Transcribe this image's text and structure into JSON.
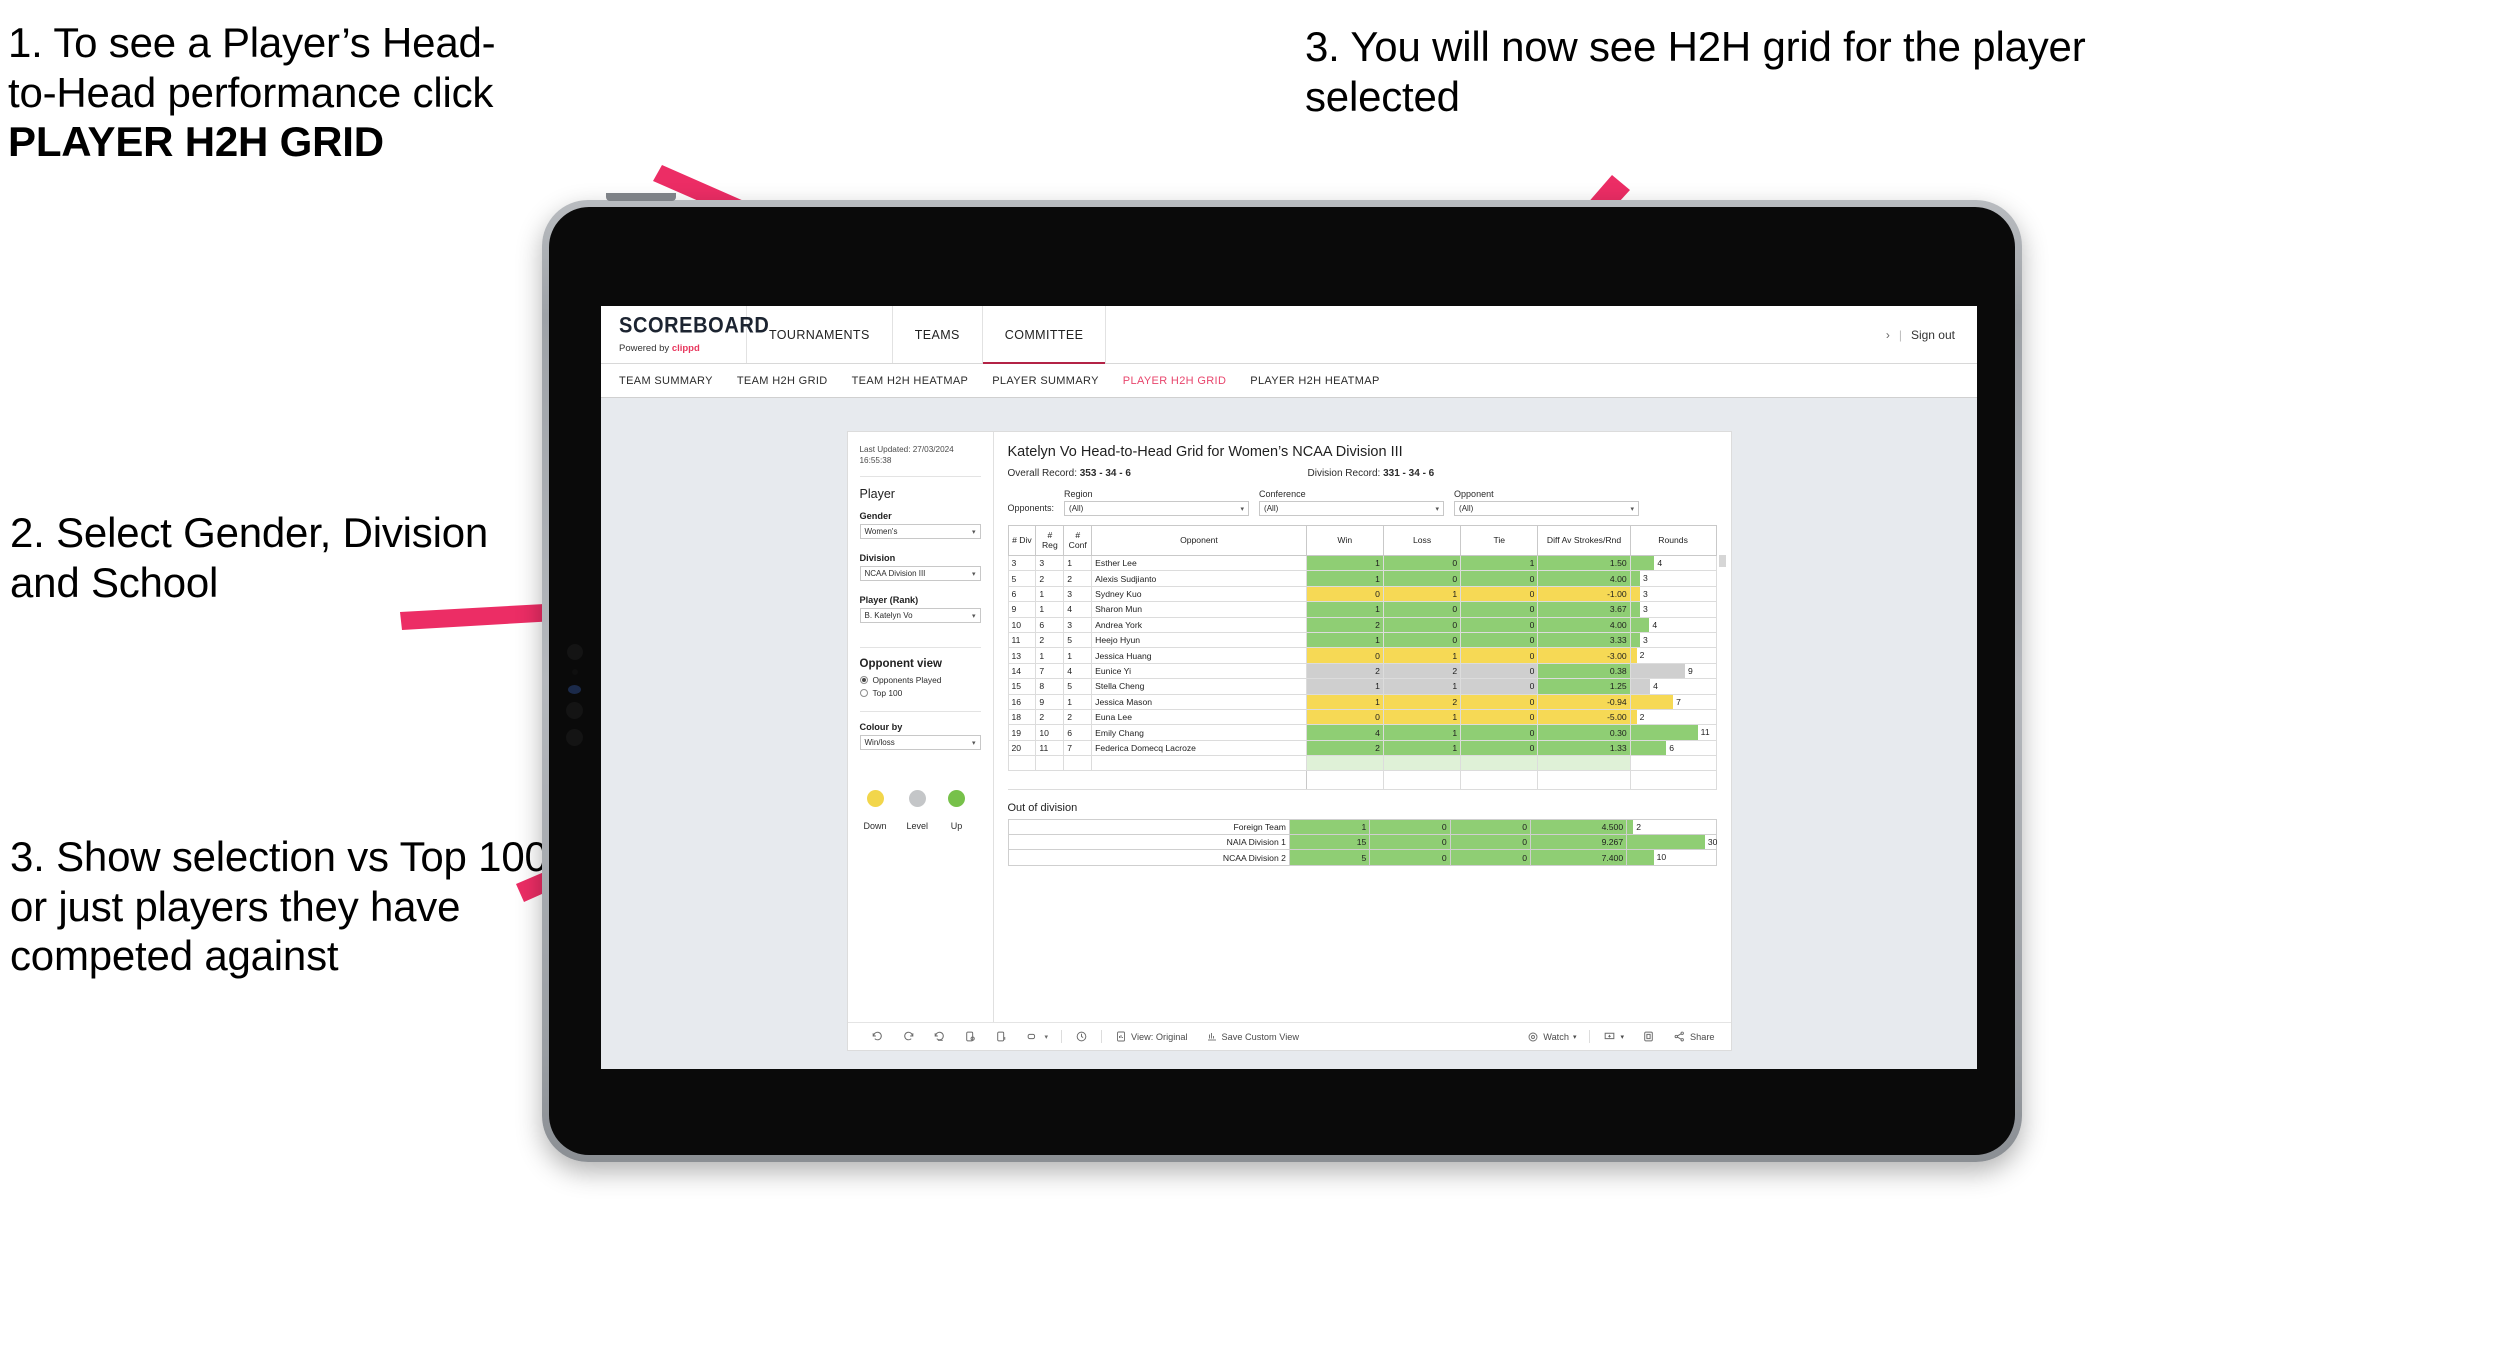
{
  "annotations": {
    "a1_line1": "1. To see a Player’s Head-",
    "a1_line2": "to-Head performance click",
    "a1_bold": "PLAYER H2H GRID",
    "a2": "2. Select Gender, Division and School",
    "a3": "3. Show selection vs Top 100 or just players they have competed against",
    "a4": "3. You will now see H2H grid for the player selected",
    "arrow_color": "#ec2d65"
  },
  "app": {
    "logo_word": "SCOREBOARD",
    "logo_sub_prefix": "Powered by ",
    "logo_brand": "clippd",
    "top_nav": [
      {
        "label": "TOURNAMENTS",
        "active": false
      },
      {
        "label": "TEAMS",
        "active": false
      },
      {
        "label": "COMMITTEE",
        "active": true
      }
    ],
    "account_chevron": "›",
    "account_sep": "|",
    "sign_out": "Sign out",
    "sub_nav": [
      {
        "label": "TEAM SUMMARY",
        "active": false
      },
      {
        "label": "TEAM H2H GRID",
        "active": false
      },
      {
        "label": "TEAM H2H HEATMAP",
        "active": false
      },
      {
        "label": "PLAYER SUMMARY",
        "active": false
      },
      {
        "label": "PLAYER H2H GRID",
        "active": true
      },
      {
        "label": "PLAYER H2H HEATMAP",
        "active": false
      }
    ],
    "accent_pink": "#e8456c"
  },
  "sidebar": {
    "last_updated": "Last Updated: 27/03/2024 16:55:38",
    "player_heading": "Player",
    "gender_label": "Gender",
    "gender_value": "Women's",
    "division_label": "Division",
    "division_value": "NCAA Division III",
    "player_rank_label": "Player (Rank)",
    "player_rank_value": "B. Katelyn Vo",
    "opponent_view_heading": "Opponent view",
    "opponent_view_options": [
      {
        "label": "Opponents Played",
        "selected": true
      },
      {
        "label": "Top 100",
        "selected": false
      }
    ],
    "colour_by_label": "Colour by",
    "colour_by_value": "Win/loss",
    "legend": [
      {
        "label": "Down",
        "color": "#f2d64b"
      },
      {
        "label": "Level",
        "color": "#c4c6c8"
      },
      {
        "label": "Up",
        "color": "#77c14a"
      }
    ]
  },
  "main": {
    "title": "Katelyn Vo Head-to-Head Grid for Women’s NCAA Division III",
    "overall_record_label": "Overall Record:",
    "overall_record_value": "353 -  34 - 6",
    "division_record_label": "Division Record:",
    "division_record_value": "331 -  34 - 6",
    "opponents_label": "Opponents:",
    "filters": [
      {
        "label": "Region",
        "value": "(All)"
      },
      {
        "label": "Conference",
        "value": "(All)"
      },
      {
        "label": "Opponent",
        "value": "(All)"
      }
    ],
    "columns": [
      "# Div",
      "# Reg",
      "# Conf",
      "Opponent",
      "Win",
      "Loss",
      "Tie",
      "Diff Av Strokes/Rnd",
      "Rounds"
    ],
    "out_of_division_title": "Out of division"
  },
  "chart_data": {
    "type": "table",
    "title": "Katelyn Vo Head-to-Head Grid for Women’s NCAA Division III",
    "columns": [
      "# Div",
      "# Reg",
      "# Conf",
      "Opponent",
      "Win",
      "Loss",
      "Tie",
      "Diff Av Strokes/Rnd",
      "Rounds"
    ],
    "rows": [
      {
        "div": "3",
        "reg": "3",
        "conf": "1",
        "opponent": "Esther Lee",
        "win": "1",
        "loss": "0",
        "tie": "1",
        "diff": "1.50",
        "rounds": "4",
        "color": "g",
        "bar_pct": 28
      },
      {
        "div": "5",
        "reg": "2",
        "conf": "2",
        "opponent": "Alexis Sudjianto",
        "win": "1",
        "loss": "0",
        "tie": "0",
        "diff": "4.00",
        "rounds": "3",
        "color": "g",
        "bar_pct": 11
      },
      {
        "div": "6",
        "reg": "1",
        "conf": "3",
        "opponent": "Sydney Kuo",
        "win": "0",
        "loss": "1",
        "tie": "0",
        "diff": "-1.00",
        "rounds": "3",
        "color": "y",
        "bar_pct": 11
      },
      {
        "div": "9",
        "reg": "1",
        "conf": "4",
        "opponent": "Sharon Mun",
        "win": "1",
        "loss": "0",
        "tie": "0",
        "diff": "3.67",
        "rounds": "3",
        "color": "g",
        "bar_pct": 11
      },
      {
        "div": "10",
        "reg": "6",
        "conf": "3",
        "opponent": "Andrea York",
        "win": "2",
        "loss": "0",
        "tie": "0",
        "diff": "4.00",
        "rounds": "4",
        "color": "g",
        "bar_pct": 22
      },
      {
        "div": "11",
        "reg": "2",
        "conf": "5",
        "opponent": "Heejo Hyun",
        "win": "1",
        "loss": "0",
        "tie": "0",
        "diff": "3.33",
        "rounds": "3",
        "color": "g",
        "bar_pct": 11
      },
      {
        "div": "13",
        "reg": "1",
        "conf": "1",
        "opponent": "Jessica Huang",
        "win": "0",
        "loss": "1",
        "tie": "0",
        "diff": "-3.00",
        "rounds": "2",
        "color": "y",
        "bar_pct": 7
      },
      {
        "div": "14",
        "reg": "7",
        "conf": "4",
        "opponent": "Eunice Yi",
        "win": "2",
        "loss": "2",
        "tie": "0",
        "diff": "0.38",
        "rounds": "9",
        "color": "gr",
        "bar_pct": 64,
        "diff_color": "g"
      },
      {
        "div": "15",
        "reg": "8",
        "conf": "5",
        "opponent": "Stella Cheng",
        "win": "1",
        "loss": "1",
        "tie": "0",
        "diff": "1.25",
        "rounds": "4",
        "color": "gr",
        "bar_pct": 23,
        "diff_color": "g"
      },
      {
        "div": "16",
        "reg": "9",
        "conf": "1",
        "opponent": "Jessica Mason",
        "win": "1",
        "loss": "2",
        "tie": "0",
        "diff": "-0.94",
        "rounds": "7",
        "color": "y",
        "bar_pct": 50
      },
      {
        "div": "18",
        "reg": "2",
        "conf": "2",
        "opponent": "Euna Lee",
        "win": "0",
        "loss": "1",
        "tie": "0",
        "diff": "-5.00",
        "rounds": "2",
        "color": "y",
        "bar_pct": 7
      },
      {
        "div": "19",
        "reg": "10",
        "conf": "6",
        "opponent": "Emily Chang",
        "win": "4",
        "loss": "1",
        "tie": "0",
        "diff": "0.30",
        "rounds": "11",
        "color": "g",
        "bar_pct": 79
      },
      {
        "div": "20",
        "reg": "11",
        "conf": "7",
        "opponent": "Federica Domecq Lacroze",
        "win": "2",
        "loss": "1",
        "tie": "0",
        "diff": "1.33",
        "rounds": "6",
        "color": "g",
        "bar_pct": 42
      }
    ],
    "out_of_division": [
      {
        "name": "Foreign Team",
        "win": "1",
        "loss": "0",
        "tie": "0",
        "diff": "4.500",
        "rounds": "2",
        "color": "g",
        "bar_pct": 7
      },
      {
        "name": "NAIA Division 1",
        "win": "15",
        "loss": "0",
        "tie": "0",
        "diff": "9.267",
        "rounds": "30",
        "color": "g",
        "bar_pct": 88
      },
      {
        "name": "NCAA Division 2",
        "win": "5",
        "loss": "0",
        "tie": "0",
        "diff": "7.400",
        "rounds": "10",
        "color": "g",
        "bar_pct": 30
      }
    ],
    "colors": {
      "up": "#8fce74",
      "down": "#f6d955",
      "level": "#cfcfcf"
    }
  },
  "toolbar": {
    "items": [
      {
        "name": "undo-icon",
        "label": ""
      },
      {
        "name": "redo-icon",
        "label": ""
      },
      {
        "name": "revert-icon",
        "label": ""
      },
      {
        "name": "refresh-icon",
        "label": ""
      },
      {
        "name": "pause-icon",
        "label": ""
      },
      {
        "name": "alerts-icon",
        "label": ""
      }
    ],
    "view_original": "View: Original",
    "save_custom_view": "Save Custom View",
    "watch": "Watch",
    "share": "Share"
  }
}
